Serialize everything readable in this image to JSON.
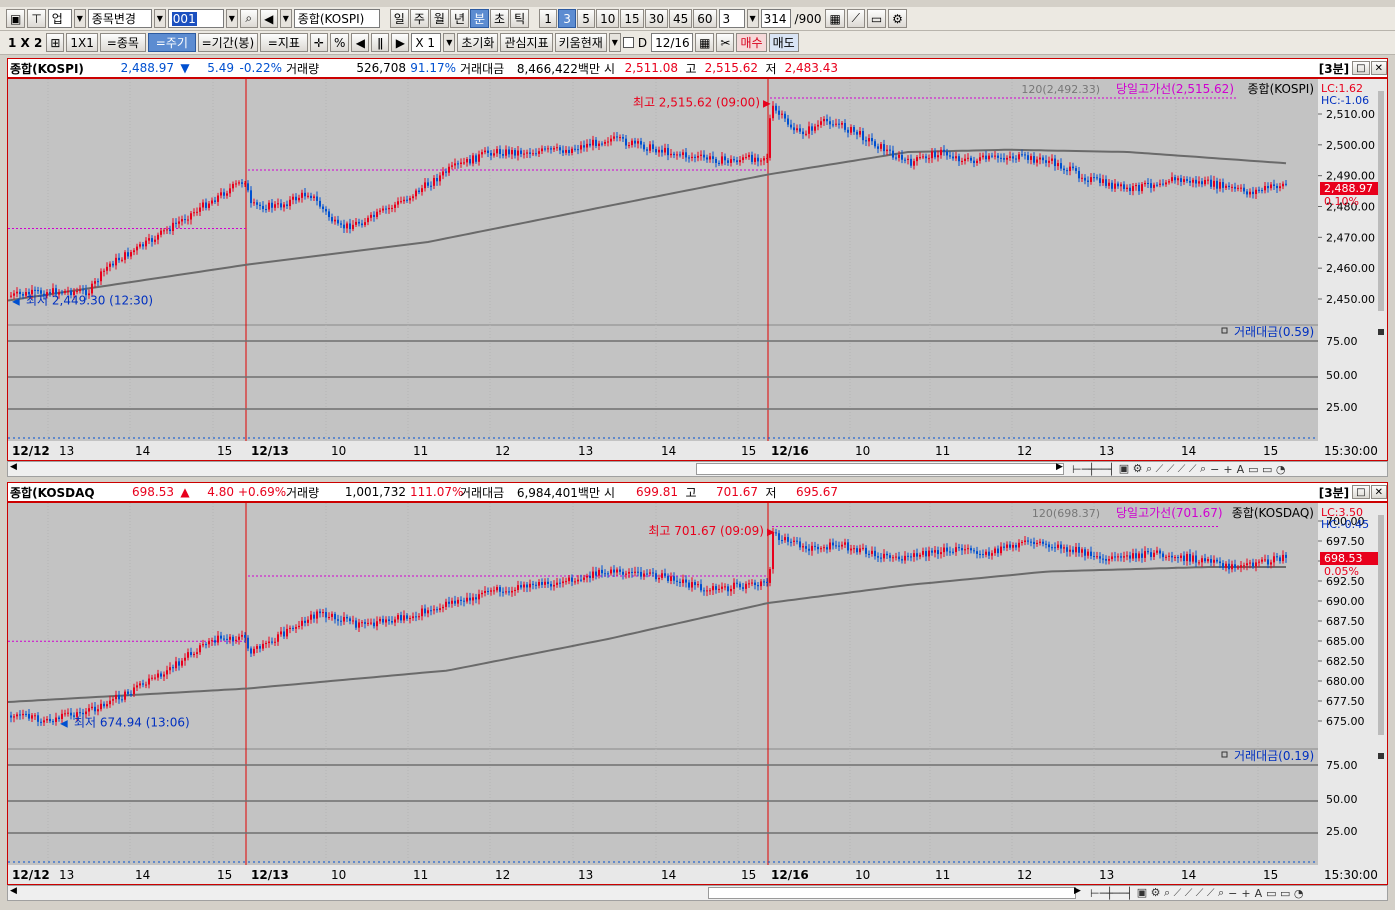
{
  "toolbar1": {
    "market_select": "업",
    "change_button": "종목변경",
    "code_input": "001",
    "symbol_name": "종합(KOSPI)",
    "periods": [
      "일",
      "주",
      "월",
      "년",
      "분",
      "초",
      "틱"
    ],
    "selected_period": "분",
    "minute_steps": [
      "1",
      "3",
      "5",
      "10",
      "15",
      "30",
      "45",
      "60"
    ],
    "selected_step": "3",
    "step_select": "3",
    "count": "314",
    "count_max": "/900"
  },
  "toolbar2": {
    "layout_1x2": "1 X 2",
    "layout_1x1": "1X1",
    "btn_symbol": "=종목",
    "btn_period": "=주기",
    "btn_range": "=기간(봉)",
    "btn_indicator": "=지표",
    "percent": "%",
    "zoom": "X 1",
    "btn_reset": "초기화",
    "btn_interest": "관심지표",
    "btn_kiwoom": "키움현재",
    "check_label": "D",
    "date_value": "12/16",
    "btn_buy": "매수",
    "btn_sell": "매도"
  },
  "colors": {
    "up": "#e8001c",
    "down": "#0050d0",
    "ma": "#6a6a6a",
    "highline": "#d000d0",
    "sep": "#e00000",
    "bg": "#c3c3c3",
    "axis": "#e8e8e8"
  },
  "panels": [
    {
      "name": "종합(KOSPI)",
      "price": "2,488.97",
      "dir": "▼",
      "change": "5.49",
      "pct": "-0.22%",
      "vol_label": "거래량",
      "vol": "526,708",
      "vol_pct": "91.17%",
      "amt_label": "거래대금",
      "amt": "8,466,422백만",
      "open_label": "시",
      "open": "2,511.08",
      "high_label": "고",
      "high": "2,515.62",
      "low_label": "저",
      "low": "2,483.43",
      "tf": "[3분]",
      "legend_ma": "120(2,492.33)",
      "legend_high": "당일고가선(2,515.62)",
      "legend_name": "종합(KOSPI)",
      "lc": "LC:1.62",
      "hc": "HC:-1.06",
      "cur_tag": "2,488.97",
      "cur_pct": "0.10%",
      "max_ann": "최고 2,515.62 (09:00)",
      "min_ann": "최저 2,449.30 (12:30)",
      "yticks": [
        "2,510.00",
        "2,500.00",
        "2,490.00",
        "2,480.00",
        "2,470.00",
        "2,460.00",
        "2,450.00"
      ],
      "sub_legend": "거래대금(0.59)",
      "sub_ticks": [
        "75.00",
        "50.00",
        "25.00"
      ],
      "xlabels": [
        "12/12",
        "13",
        "14",
        "15",
        "12/13",
        "10",
        "11",
        "12",
        "13",
        "14",
        "15",
        "12/16",
        "10",
        "11",
        "12",
        "13",
        "14",
        "15"
      ],
      "end_time": "15:30:00"
    },
    {
      "name": "종합(KOSDAQ",
      "price": "698.53",
      "dir": "▲",
      "change": "4.80",
      "pct": "+0.69%",
      "vol_label": "거래량",
      "vol": "1,001,732",
      "vol_pct": "111.07%",
      "amt_label": "거래대금",
      "amt": "6,984,401백만",
      "open_label": "시",
      "open": "699.81",
      "high_label": "고",
      "high": "701.67",
      "low_label": "저",
      "low": "695.67",
      "tf": "[3분]",
      "legend_ma": "120(698.37)",
      "legend_high": "당일고가선(701.67)",
      "legend_name": "종합(KOSDAQ)",
      "lc": "LC:3.50",
      "hc": "HC:-0.45",
      "cur_tag": "698.53",
      "cur_pct": "0.05%",
      "max_ann": "최고 701.67 (09:09)",
      "min_ann": "최저 674.94 (13:06)",
      "yticks": [
        "700.00",
        "697.50",
        "695.00",
        "692.50",
        "690.00",
        "687.50",
        "685.00",
        "682.50",
        "680.00",
        "677.50",
        "675.00"
      ],
      "sub_legend": "거래대금(0.19)",
      "sub_ticks": [
        "75.00",
        "50.00",
        "25.00"
      ],
      "xlabels": [
        "12/12",
        "13",
        "14",
        "15",
        "12/13",
        "10",
        "11",
        "12",
        "13",
        "14",
        "15",
        "12/16",
        "10",
        "11",
        "12",
        "13",
        "14",
        "15"
      ],
      "end_time": "15:30:00"
    }
  ]
}
